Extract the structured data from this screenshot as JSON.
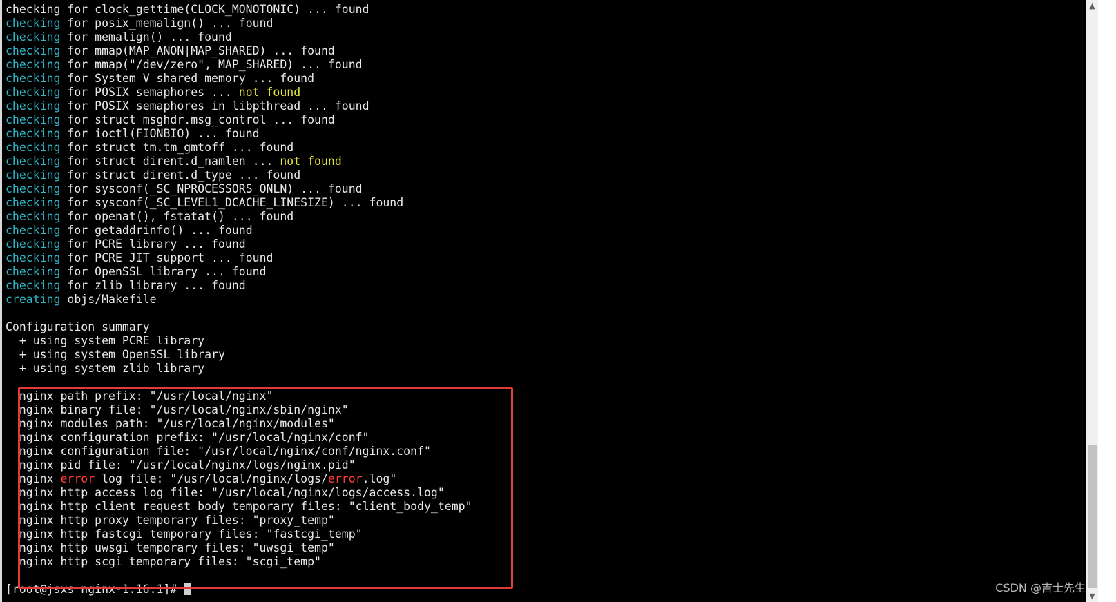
{
  "terminal": {
    "colors": {
      "background": "#000000",
      "text": "#e8e8e8",
      "keyword": "#2fb7c7",
      "warning": "#e3e33b",
      "error_word": "#ff3b3b",
      "highlight_box": "#e53935"
    },
    "lines": [
      [
        {
          "t": "checking for clock_gettime(CLOCK_MONOTONIC) ... found",
          "c": "plain"
        }
      ],
      [
        {
          "t": "checking",
          "c": "cyan"
        },
        {
          "t": " for posix_memalign() ... found",
          "c": "plain"
        }
      ],
      [
        {
          "t": "checking",
          "c": "cyan"
        },
        {
          "t": " for memalign() ... found",
          "c": "plain"
        }
      ],
      [
        {
          "t": "checking",
          "c": "cyan"
        },
        {
          "t": " for mmap(MAP_ANON|MAP_SHARED) ... found",
          "c": "plain"
        }
      ],
      [
        {
          "t": "checking",
          "c": "cyan"
        },
        {
          "t": " for mmap(\"/dev/zero\", MAP_SHARED) ... found",
          "c": "plain"
        }
      ],
      [
        {
          "t": "checking",
          "c": "cyan"
        },
        {
          "t": " for System V shared memory ... found",
          "c": "plain"
        }
      ],
      [
        {
          "t": "checking",
          "c": "cyan"
        },
        {
          "t": " for POSIX semaphores ... ",
          "c": "plain"
        },
        {
          "t": "not found",
          "c": "yellow"
        }
      ],
      [
        {
          "t": "checking",
          "c": "cyan"
        },
        {
          "t": " for POSIX semaphores in libpthread ... found",
          "c": "plain"
        }
      ],
      [
        {
          "t": "checking",
          "c": "cyan"
        },
        {
          "t": " for struct msghdr.msg_control ... found",
          "c": "plain"
        }
      ],
      [
        {
          "t": "checking",
          "c": "cyan"
        },
        {
          "t": " for ioctl(FIONBIO) ... found",
          "c": "plain"
        }
      ],
      [
        {
          "t": "checking",
          "c": "cyan"
        },
        {
          "t": " for struct tm.tm_gmtoff ... found",
          "c": "plain"
        }
      ],
      [
        {
          "t": "checking",
          "c": "cyan"
        },
        {
          "t": " for struct dirent.d_namlen ... ",
          "c": "plain"
        },
        {
          "t": "not found",
          "c": "yellow"
        }
      ],
      [
        {
          "t": "checking",
          "c": "cyan"
        },
        {
          "t": " for struct dirent.d_type ... found",
          "c": "plain"
        }
      ],
      [
        {
          "t": "checking",
          "c": "cyan"
        },
        {
          "t": " for sysconf(_SC_NPROCESSORS_ONLN) ... found",
          "c": "plain"
        }
      ],
      [
        {
          "t": "checking",
          "c": "cyan"
        },
        {
          "t": " for sysconf(_SC_LEVEL1_DCACHE_LINESIZE) ... found",
          "c": "plain"
        }
      ],
      [
        {
          "t": "checking",
          "c": "cyan"
        },
        {
          "t": " for openat(), fstatat() ... found",
          "c": "plain"
        }
      ],
      [
        {
          "t": "checking",
          "c": "cyan"
        },
        {
          "t": " for getaddrinfo() ... found",
          "c": "plain"
        }
      ],
      [
        {
          "t": "checking",
          "c": "cyan"
        },
        {
          "t": " for PCRE library ... found",
          "c": "plain"
        }
      ],
      [
        {
          "t": "checking",
          "c": "cyan"
        },
        {
          "t": " for PCRE JIT support ... found",
          "c": "plain"
        }
      ],
      [
        {
          "t": "checking",
          "c": "cyan"
        },
        {
          "t": " for OpenSSL library ... found",
          "c": "plain"
        }
      ],
      [
        {
          "t": "checking",
          "c": "cyan"
        },
        {
          "t": " for zlib library ... found",
          "c": "plain"
        }
      ],
      [
        {
          "t": "creating",
          "c": "cyan"
        },
        {
          "t": " objs/Makefile",
          "c": "plain"
        }
      ],
      [],
      [
        {
          "t": "Configuration summary",
          "c": "plain"
        }
      ],
      [
        {
          "t": "  + using system PCRE library",
          "c": "plain"
        }
      ],
      [
        {
          "t": "  + using system OpenSSL library",
          "c": "plain"
        }
      ],
      [
        {
          "t": "  + using system zlib library",
          "c": "plain"
        }
      ],
      [],
      [
        {
          "t": "  nginx path prefix: \"/usr/local/nginx\"",
          "c": "plain"
        }
      ],
      [
        {
          "t": "  nginx binary file: \"/usr/local/nginx/sbin/nginx\"",
          "c": "plain"
        }
      ],
      [
        {
          "t": "  nginx modules path: \"/usr/local/nginx/modules\"",
          "c": "plain"
        }
      ],
      [
        {
          "t": "  nginx configuration prefix: \"/usr/local/nginx/conf\"",
          "c": "plain"
        }
      ],
      [
        {
          "t": "  nginx configuration file: \"/usr/local/nginx/conf/nginx.conf\"",
          "c": "plain"
        }
      ],
      [
        {
          "t": "  nginx pid file: \"/usr/local/nginx/logs/nginx.pid\"",
          "c": "plain"
        }
      ],
      [
        {
          "t": "  nginx ",
          "c": "plain"
        },
        {
          "t": "error",
          "c": "red"
        },
        {
          "t": " log file: \"/usr/local/nginx/logs/",
          "c": "plain"
        },
        {
          "t": "error",
          "c": "red"
        },
        {
          "t": ".log\"",
          "c": "plain"
        }
      ],
      [
        {
          "t": "  nginx http access log file: \"/usr/local/nginx/logs/access.log\"",
          "c": "plain"
        }
      ],
      [
        {
          "t": "  nginx http client request body temporary files: \"client_body_temp\"",
          "c": "plain"
        }
      ],
      [
        {
          "t": "  nginx http proxy temporary files: \"proxy_temp\"",
          "c": "plain"
        }
      ],
      [
        {
          "t": "  nginx http fastcgi temporary files: \"fastcgi_temp\"",
          "c": "plain"
        }
      ],
      [
        {
          "t": "  nginx http uwsgi temporary files: \"uwsgi_temp\"",
          "c": "plain"
        }
      ],
      [
        {
          "t": "  nginx http scgi temporary files: \"scgi_temp\"",
          "c": "plain"
        }
      ],
      [],
      [
        {
          "t": "[root@jsxs nginx-1.16.1]# ",
          "c": "plain"
        }
      ]
    ],
    "prompt_line_index": 42
  },
  "scrollbar": {
    "up_icon": "▲",
    "down_icon": "▼",
    "thumb_position": 0.87
  },
  "watermark": {
    "text": "CSDN @吉士先生"
  }
}
